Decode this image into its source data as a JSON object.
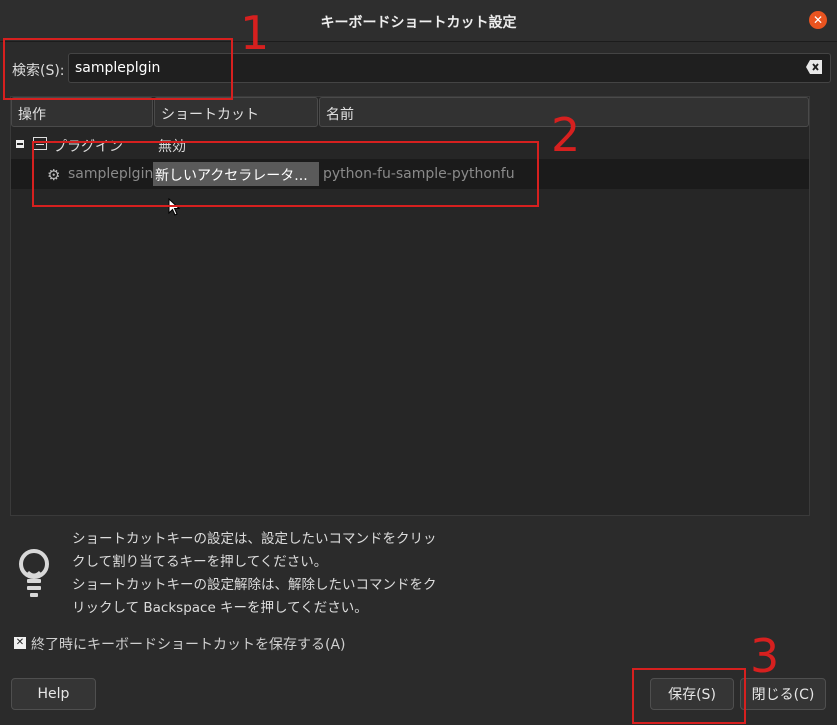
{
  "window": {
    "title": "キーボードショートカット設定",
    "close_glyph": "✕"
  },
  "search": {
    "label": "検索(S):",
    "value": "sampleplgin"
  },
  "columns": {
    "action": "操作",
    "shortcut": "ショートカット",
    "name": "名前"
  },
  "rows": [
    {
      "action": "プラグイン",
      "shortcut": "無効",
      "name": ""
    },
    {
      "action": "sampleplgin",
      "shortcut": "新しいアクセラレータ...",
      "name": "python-fu-sample-pythonfu"
    }
  ],
  "hint": {
    "lines": [
      "ショートカットキーの設定は、設定したいコマンドをクリッ",
      "クして割り当てるキーを押してください。",
      "ショートカットキーの設定解除は、解除したいコマンドをク",
      "リックして Backspace キーを押してください。"
    ]
  },
  "save_on_exit": {
    "label": "終了時にキーボードショートカットを保存する(A)",
    "checked": true
  },
  "buttons": {
    "help": "Help",
    "save": "保存(S)",
    "close": "閉じる(C)"
  },
  "annotations": {
    "n1": "1",
    "n2": "2",
    "n3": "3",
    "color": "#d6201f"
  },
  "icons": {
    "clear": "backspace-clear-icon",
    "hint": "lightbulb-icon",
    "gear": "gear-icon",
    "folder": "folder-icon"
  }
}
